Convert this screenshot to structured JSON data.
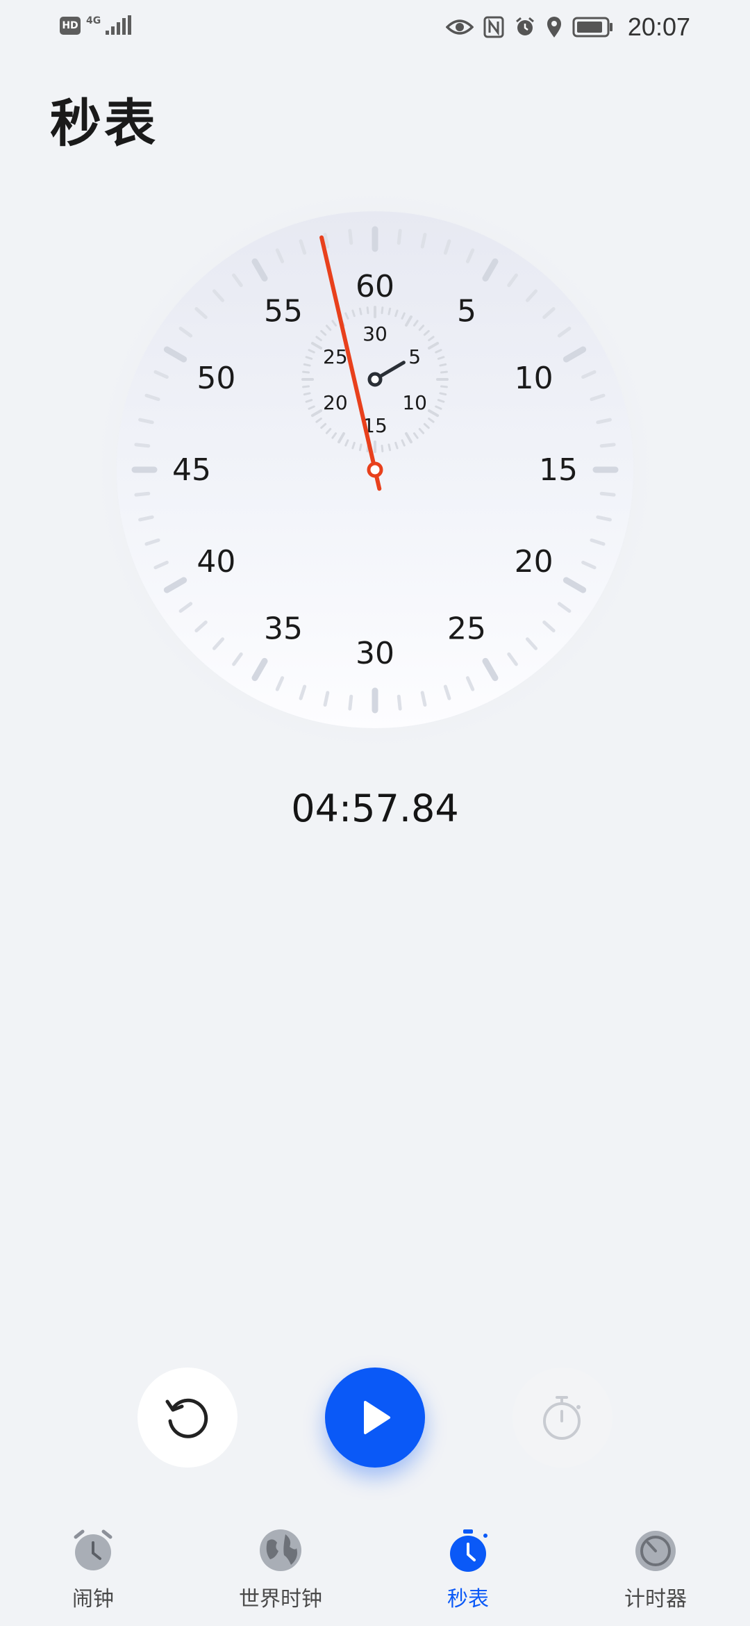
{
  "status_bar": {
    "hd": "HD",
    "network": "4G",
    "time": "20:07",
    "icons": [
      "hd-icon",
      "signal-icon",
      "eye-icon",
      "nfc-icon",
      "alarm-icon",
      "location-icon",
      "battery-icon"
    ]
  },
  "page": {
    "title": "秒表"
  },
  "dial": {
    "outer_labels": [
      "60",
      "5",
      "10",
      "15",
      "20",
      "25",
      "30",
      "35",
      "40",
      "45",
      "50",
      "55"
    ],
    "inner_labels": [
      "30",
      "5",
      "10",
      "15",
      "20",
      "25"
    ],
    "elapsed_seconds": 57.84,
    "elapsed_minutes": 4
  },
  "stopwatch": {
    "elapsed": "04:57.84"
  },
  "controls": {
    "reset": "reset-icon",
    "play": "play-icon",
    "lap": "lap-icon"
  },
  "tabs": [
    {
      "label": "闹钟",
      "icon": "alarm-clock-icon",
      "active": false
    },
    {
      "label": "世界时钟",
      "icon": "globe-icon",
      "active": false
    },
    {
      "label": "秒表",
      "icon": "stopwatch-icon",
      "active": true
    },
    {
      "label": "计时器",
      "icon": "timer-icon",
      "active": false
    }
  ],
  "colors": {
    "accent": "#0A59F7",
    "second_hand": "#E8401C",
    "background": "#F1F3F6"
  }
}
